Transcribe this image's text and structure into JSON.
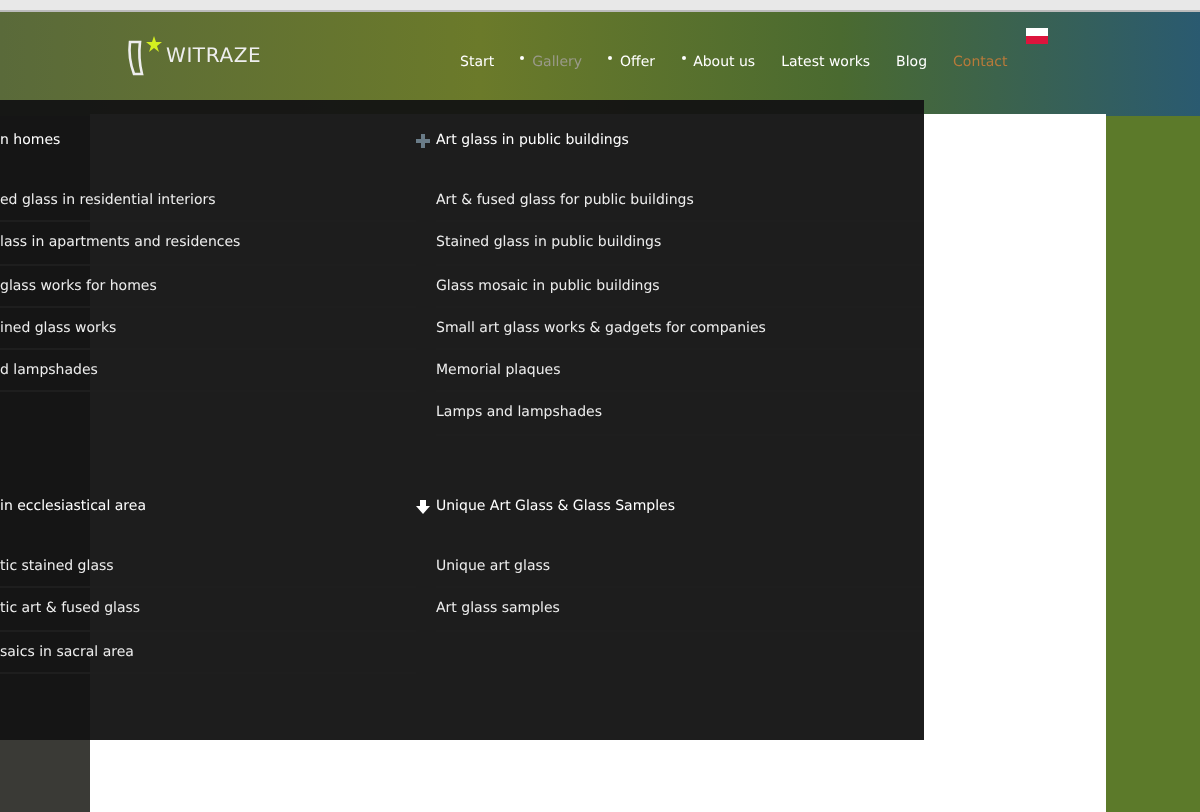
{
  "header": {
    "logo": "WITRAZE",
    "nav": [
      {
        "label": "Start",
        "has_submenu": false,
        "open": false,
        "selected": false
      },
      {
        "label": "Gallery",
        "has_submenu": true,
        "open": true,
        "selected": false
      },
      {
        "label": "Offer",
        "has_submenu": true,
        "open": false,
        "selected": false
      },
      {
        "label": "About us",
        "has_submenu": true,
        "open": false,
        "selected": false
      },
      {
        "label": "Latest works",
        "has_submenu": false,
        "open": false,
        "selected": false
      },
      {
        "label": "Blog",
        "has_submenu": false,
        "open": false,
        "selected": false
      },
      {
        "label": "Contact",
        "has_submenu": false,
        "open": false,
        "selected": true
      }
    ]
  },
  "mega_menu": {
    "columns": [
      {
        "groups": [
          {
            "heading": "n homes",
            "items": [
              "ed glass in residential interiors",
              "lass in apartments and residences",
              " glass works for homes",
              "ined glass works",
              "d lampshades"
            ]
          },
          {
            "heading": "in ecclesiastical area",
            "items": [
              "tic stained glass",
              "tic art & fused glass",
              "saics in sacral area"
            ]
          }
        ]
      },
      {
        "groups": [
          {
            "heading": "Art glass in public buildings",
            "hovered": false,
            "items": [
              "Art & fused glass for public buildings",
              "Stained glass in public buildings",
              "Glass mosaic in public buildings",
              "Small art glass works & gadgets for companies",
              "Memorial plaques",
              "Lamps and lampshades"
            ]
          },
          {
            "heading": "Unique Art Glass & Glass Samples",
            "hovered": true,
            "items": [
              "Unique art glass",
              "Art glass samples"
            ]
          }
        ]
      }
    ]
  }
}
